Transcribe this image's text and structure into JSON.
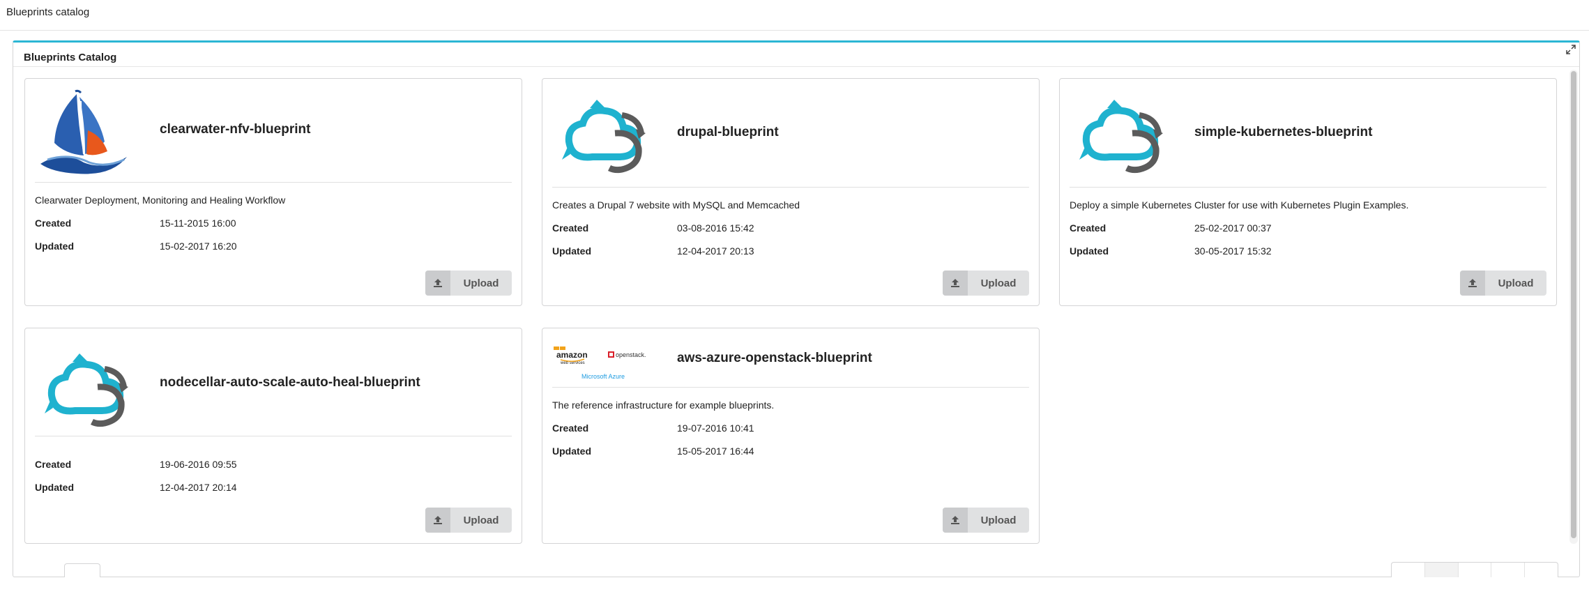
{
  "page": {
    "title": "Blueprints catalog"
  },
  "widget": {
    "title": "Blueprints Catalog"
  },
  "cards": [
    {
      "name": "clearwater-nfv-blueprint",
      "description": "Clearwater Deployment, Monitoring and Healing Workflow",
      "created_label": "Created",
      "created": "15-11-2015 16:00",
      "updated_label": "Updated",
      "updated": "15-02-2017 16:20",
      "upload_label": "Upload",
      "logo": "sailboat-logo"
    },
    {
      "name": "drupal-blueprint",
      "description": "Creates a Drupal 7 website with MySQL and Memcached",
      "created_label": "Created",
      "created": "03-08-2016 15:42",
      "updated_label": "Updated",
      "updated": "12-04-2017 20:13",
      "upload_label": "Upload",
      "logo": "cloudify-logo"
    },
    {
      "name": "simple-kubernetes-blueprint",
      "description": "Deploy a simple Kubernetes Cluster for use with Kubernetes Plugin Examples.",
      "created_label": "Created",
      "created": "25-02-2017 00:37",
      "updated_label": "Updated",
      "updated": "30-05-2017 15:32",
      "upload_label": "Upload",
      "logo": "cloudify-logo"
    },
    {
      "name": "nodecellar-auto-scale-auto-heal-blueprint",
      "description": "",
      "created_label": "Created",
      "created": "19-06-2016 09:55",
      "updated_label": "Updated",
      "updated": "12-04-2017 20:14",
      "upload_label": "Upload",
      "logo": "cloudify-logo"
    },
    {
      "name": "aws-azure-openstack-blueprint",
      "description": "The reference infrastructure for example blueprints.",
      "created_label": "Created",
      "created": "19-07-2016 10:41",
      "updated_label": "Updated",
      "updated": "15-05-2017 16:44",
      "upload_label": "Upload",
      "logo": "aws-azure-openstack-logo",
      "logo_text": {
        "amazon": "amazon",
        "aws": "web services",
        "openstack": "openstack.",
        "azure": "Microsoft Azure"
      }
    }
  ],
  "colors": {
    "accent": "#2bb6d4",
    "cloud_blue": "#1fb2cf",
    "cloud_gray": "#5b5b5b"
  }
}
